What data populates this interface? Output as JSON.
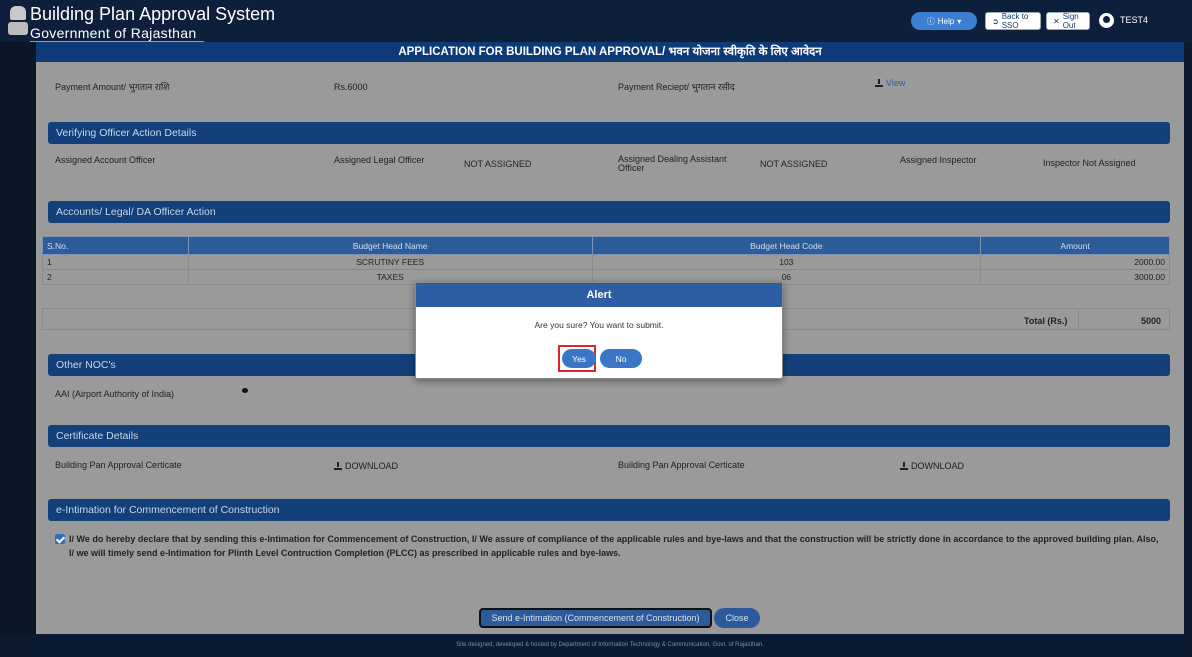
{
  "header": {
    "app_title": "Building Plan Approval System",
    "app_subtitle": "Government of Rajasthan",
    "help_label": "Help",
    "back_sso_label": "Back to SSO",
    "sign_out_label": "Sign Out",
    "user_name": "TEST4"
  },
  "form_title": "APPLICATION FOR BUILDING PLAN APPROVAL/ भवन योजना स्वीकृति के लिए आवेदन",
  "payment": {
    "amount_label": "Payment Amount/ भुगतान राशि",
    "amount_value": "Rs.6000",
    "receipt_label": "Payment Reciept/ भुगतान रसीद",
    "view_label": "View"
  },
  "verifying": {
    "title": "Verifying Officer Action Details",
    "account_officer_label": "Assigned Account Officer",
    "legal_officer_label": "Assigned Legal Officer",
    "legal_officer_value": "NOT ASSIGNED",
    "dealing_assistant_label": "Assigned Dealing Assistant Officer",
    "dealing_assistant_value": "NOT ASSIGNED",
    "inspector_label": "Assigned Inspector",
    "inspector_value": "Inspector Not Assigned"
  },
  "accounts": {
    "title": "Accounts/ Legal/ DA Officer Action",
    "columns": [
      "S.No.",
      "Budget Head Name",
      "Budget Head Code",
      "Amount"
    ],
    "rows": [
      [
        "1",
        "SCRUTINY FEES",
        "103",
        "2000.00"
      ],
      [
        "2",
        "TAXES",
        "06",
        "3000.00"
      ]
    ],
    "total_label": "Total (Rs.)",
    "total_value": "5000"
  },
  "noc": {
    "title": "Other NOC's",
    "aai_label": "AAI (Airport Authority of India)"
  },
  "certificate": {
    "title": "Certificate Details",
    "label_1": "Building Pan Approval Certicate",
    "download_1": "DOWNLOAD",
    "label_2": "Building Pan Approval Certicate",
    "download_2": "DOWNLOAD"
  },
  "intimation": {
    "title": "e-Intimation for Commencement of Construction",
    "declaration": "I/ We do hereby declare that by sending this e-Intimation for Commencement of Construction, I/ We assure of compliance of the applicable rules and bye-laws and that the construction will be strictly done in accordance to the approved building plan. Also, I/ we will timely send e-Intimation for Plinth Level Contruction Completion (PLCC) as prescribed in applicable rules and bye-laws.",
    "send_label": "Send e-Intimation (Commencement of Construction)",
    "close_label": "Close"
  },
  "footer": "Site designed, developed & hosted by Department of Information Technology & Communication, Govt. of Rajasthan.",
  "modal": {
    "title": "Alert",
    "message": "Are you sure? You want to submit.",
    "yes_label": "Yes",
    "no_label": "No"
  }
}
